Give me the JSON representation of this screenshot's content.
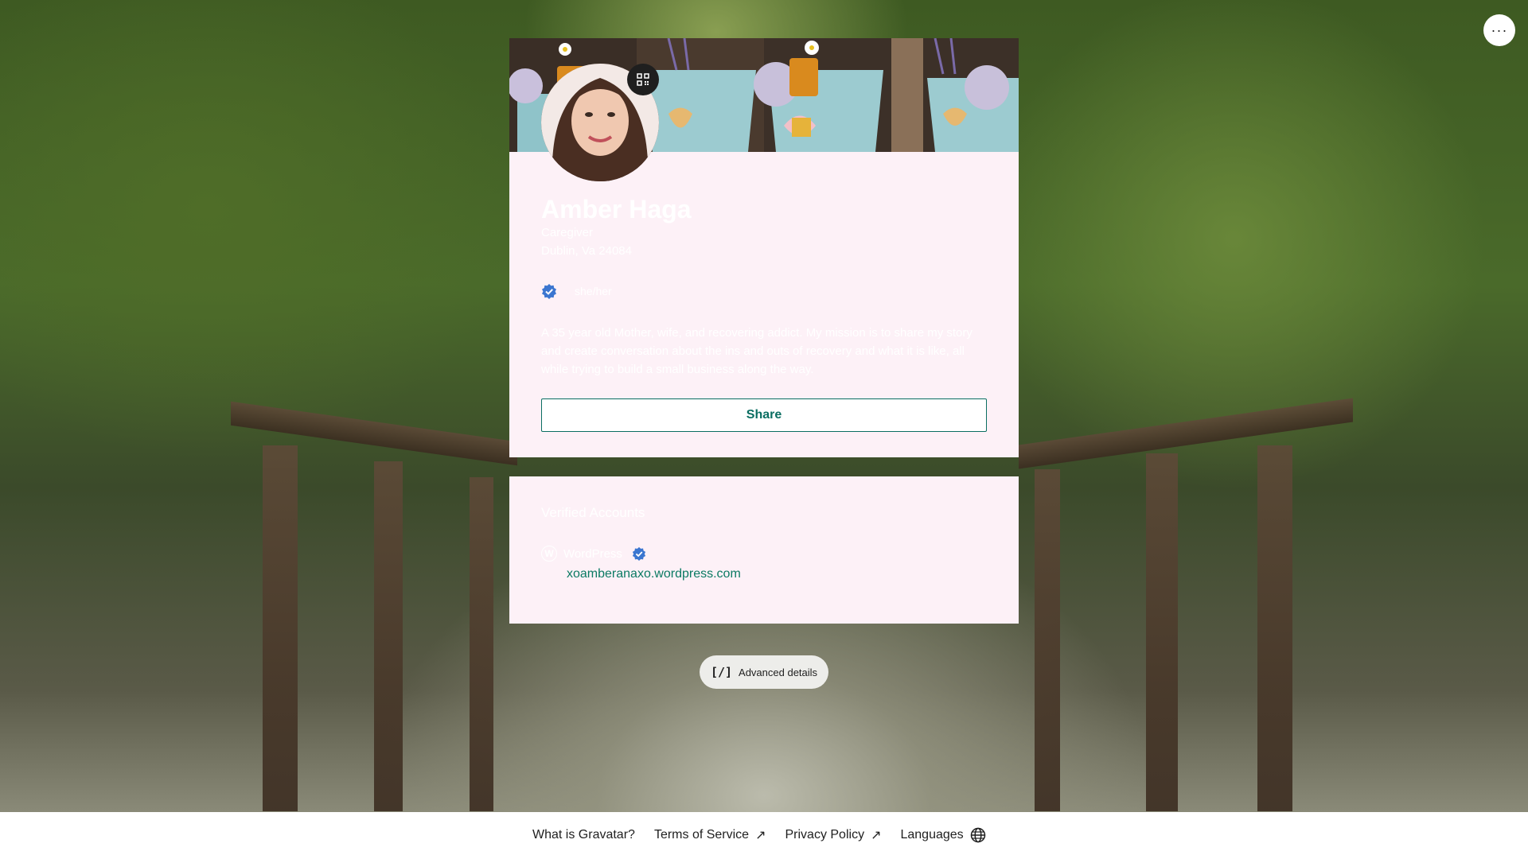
{
  "more_menu": {
    "icon": "more-horizontal-icon",
    "label": "···"
  },
  "profile": {
    "name": "Amber Haga",
    "job_title": "Caregiver",
    "location": "Dublin, Va 24084",
    "pronouns": "she/her",
    "bio": "A 35 year old Mother, wife, and recovering addict. My mission is to share my story and create conversation about the ins and outs of recovery and what it is like, all while trying to build a small business along the way.",
    "share_label": "Share",
    "qr_icon": "qr-code-icon",
    "verified_icon": "verified-badge-icon"
  },
  "verified_accounts": {
    "title": "Verified Accounts",
    "items": [
      {
        "service": "WordPress",
        "url": "xoamberanaxo.wordpress.com",
        "icon": "wordpress-icon"
      }
    ]
  },
  "advanced_details": {
    "icon_text": "[/]",
    "label": "Advanced details"
  },
  "footer": {
    "what_is": "What is Gravatar?",
    "terms": "Terms of Service",
    "privacy": "Privacy Policy",
    "languages": "Languages",
    "arrow": "↗"
  },
  "colors": {
    "accent": "#0b6e62",
    "card_bg": "#fdf1f7",
    "link": "#0b7a63"
  }
}
